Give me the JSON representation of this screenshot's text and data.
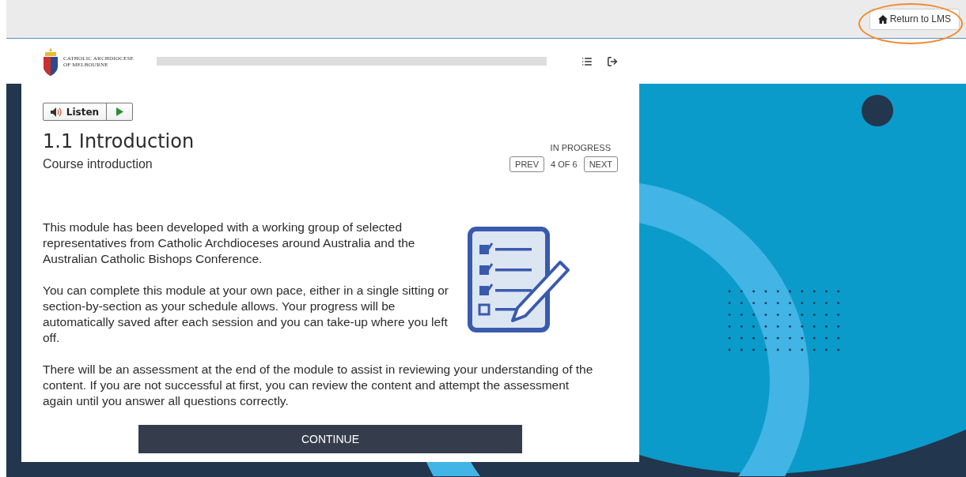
{
  "top_bar": {
    "return_button": "Return to LMS"
  },
  "header": {
    "logo_lines": [
      "CATHOLIC ARCHDIOCESE",
      "OF MELBOURNE"
    ]
  },
  "lesson": {
    "listen_label": "Listen",
    "title": "1.1 Introduction",
    "subtitle": "Course introduction",
    "status": "IN PROGRESS",
    "pagination": {
      "prev": "PREV",
      "position": "4 OF 6",
      "next": "NEXT"
    },
    "paragraphs": [
      "This module has been developed with a working group of selected representatives from Catholic Archdioceses around Australia and the Australian Catholic Bishops Conference.",
      "You can complete this module at your own pace, either in a single sitting or section-by-section as your schedule allows. Your progress will be automatically saved after each session and you can take-up where you left off.",
      "There will be an assessment at the end of the module to assist in reviewing your understanding of the content. If you are not successful at first, you can review the content and attempt the assessment again until you answer all questions correctly."
    ],
    "continue_button": "CONTINUE"
  }
}
